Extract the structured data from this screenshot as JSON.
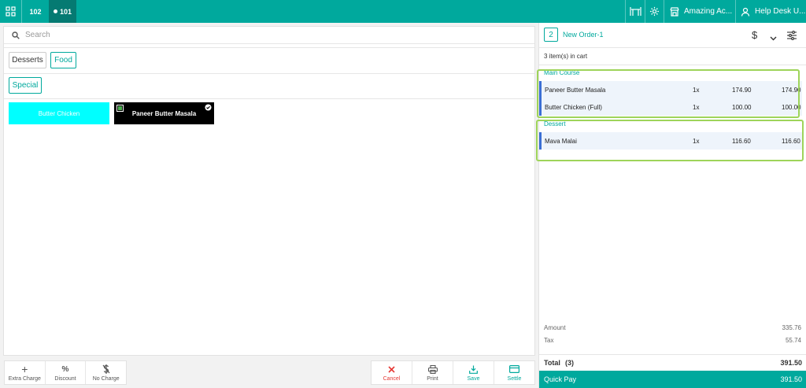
{
  "topbar": {
    "tables": [
      {
        "label": "102",
        "active": false
      },
      {
        "label": "101",
        "active": true
      }
    ],
    "outlet_name": "Amazing Ac...",
    "user_name": "Help Desk U..."
  },
  "search": {
    "placeholder": "Search",
    "value": ""
  },
  "categories": [
    {
      "label": "Desserts",
      "active": false
    },
    {
      "label": "Food",
      "active": true
    }
  ],
  "subcategories": [
    {
      "label": "Special",
      "active": true
    }
  ],
  "items": [
    {
      "label": "Butter Chicken",
      "bg": "#00ffff",
      "color": "#ffffff",
      "selected": false
    },
    {
      "label": "Paneer Butter Masala",
      "bg": "#000000",
      "color": "#ffffff",
      "selected": true
    }
  ],
  "bottom_left_actions": [
    {
      "label": "Extra Charge",
      "icon": "plus-icon"
    },
    {
      "label": "Discount",
      "icon": "percent-icon"
    },
    {
      "label": "No Charge",
      "icon": "no-charge-icon"
    }
  ],
  "bottom_right_actions": [
    {
      "label": "Cancel",
      "icon": "close-icon",
      "color": "#e53935"
    },
    {
      "label": "Print",
      "icon": "printer-icon",
      "color": "#555555"
    },
    {
      "label": "Save",
      "icon": "download-icon",
      "color": "#00a99d"
    },
    {
      "label": "Settle",
      "icon": "card-icon",
      "color": "#00a99d"
    }
  ],
  "order": {
    "count": "2",
    "name": "New Order-1",
    "currency_symbol": "$",
    "cart_count_text": "3 item(s) in cart",
    "sections": [
      {
        "title": "Main Course",
        "items": [
          {
            "name": "Paneer Butter Masala",
            "qty": "1x",
            "price": "174.90",
            "total": "174.90"
          },
          {
            "name": "Butter Chicken (Full)",
            "qty": "1x",
            "price": "100.00",
            "total": "100.00"
          }
        ]
      },
      {
        "title": "Dessert",
        "items": [
          {
            "name": "Mava Malai",
            "qty": "1x",
            "price": "116.60",
            "total": "116.60"
          }
        ]
      }
    ],
    "amount_label": "Amount",
    "amount_value": "335.76",
    "tax_label": "Tax",
    "tax_value": "55.74",
    "total_label": "Total",
    "total_count": "(3)",
    "total_value": "391.50",
    "quick_pay_label": "Quick Pay",
    "quick_pay_value": "391.50"
  },
  "colors": {
    "accent": "#00a99d",
    "accent_dark": "#057a72",
    "highlight_box": "#9ed45a",
    "row_marker": "#3b6fd4"
  }
}
